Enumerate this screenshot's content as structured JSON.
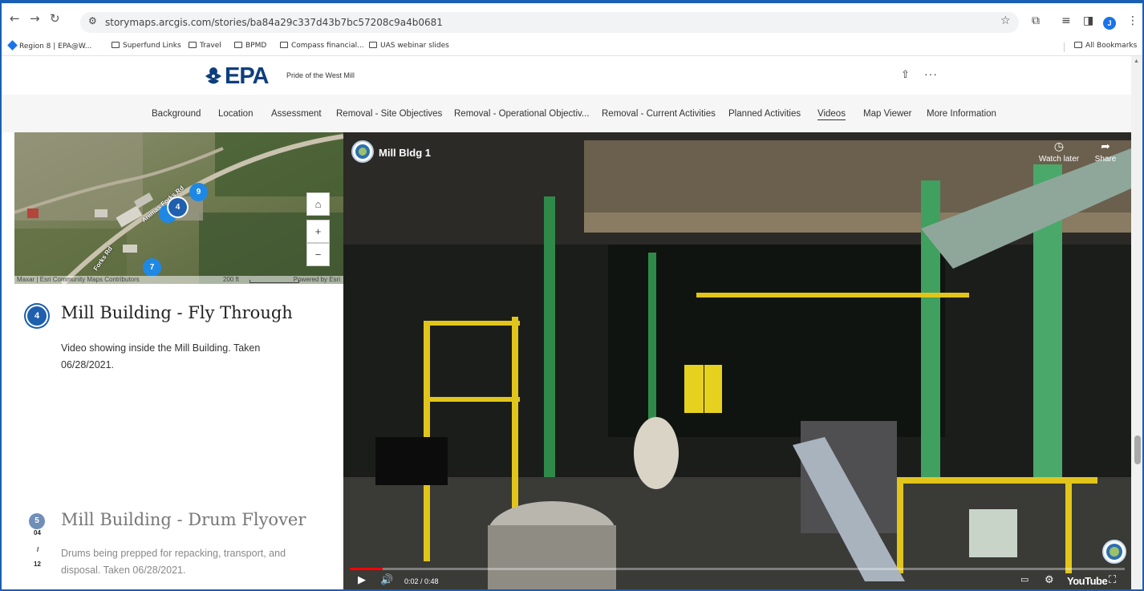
{
  "browser": {
    "url": "storymaps.arcgis.com/stories/ba84a29c337d43b7bc57208c9a4b0681",
    "profile_initial": "J",
    "bookmarks": [
      {
        "label": "Region 8 | EPA@W...",
        "type": "site"
      },
      {
        "label": "Superfund Links",
        "type": "folder"
      },
      {
        "label": "Travel",
        "type": "folder"
      },
      {
        "label": "BPMD",
        "type": "folder"
      },
      {
        "label": "Compass financial...",
        "type": "folder"
      },
      {
        "label": "UAS webinar slides",
        "type": "folder"
      }
    ],
    "all_bookmarks": "All Bookmarks"
  },
  "header": {
    "logo_text": "EPA",
    "story_title": "Pride of the West Mill"
  },
  "nav": {
    "items": [
      {
        "label": "Background"
      },
      {
        "label": "Location"
      },
      {
        "label": "Assessment"
      },
      {
        "label": "Removal - Site Objectives"
      },
      {
        "label": "Removal - Operational Objectiv..."
      },
      {
        "label": "Removal - Current Activities"
      },
      {
        "label": "Planned Activities"
      },
      {
        "label": "Videos",
        "active": true
      },
      {
        "label": "Map Viewer"
      },
      {
        "label": "More Information"
      }
    ]
  },
  "map": {
    "markers": [
      "9",
      "4",
      "7"
    ],
    "road_label_1": "Animas Forks Rd",
    "road_label_2": "Forks Rd",
    "attribution_left": "Maxar | Esri Community Maps Contributors",
    "scale": "200 ft",
    "attribution_right": "Powered by Esri",
    "controls": {
      "home": "⌂",
      "zoom_in": "+",
      "zoom_out": "−"
    }
  },
  "steps": [
    {
      "number": "4",
      "title": "Mill Building - Fly Through",
      "description": "Video showing inside the Mill Building. Taken 06/28/2021."
    },
    {
      "number": "5",
      "title": "Mill Building - Drum Flyover",
      "description": "Drums being prepped for repacking, transport, and disposal. Taken 06/28/2021."
    }
  ],
  "progress": {
    "current": "04",
    "sep": "/",
    "total": "12"
  },
  "video": {
    "title": "Mill Bldg 1",
    "watch_later": "Watch later",
    "share": "Share",
    "time": "0:02 / 0:48",
    "played_fraction": 0.042,
    "youtube": "YouTube"
  },
  "colors": {
    "accent": "#1e5fae",
    "epa_blue": "#0e3f7d",
    "marker_blue": "#1e88e5",
    "progress_red": "#ff0000"
  }
}
